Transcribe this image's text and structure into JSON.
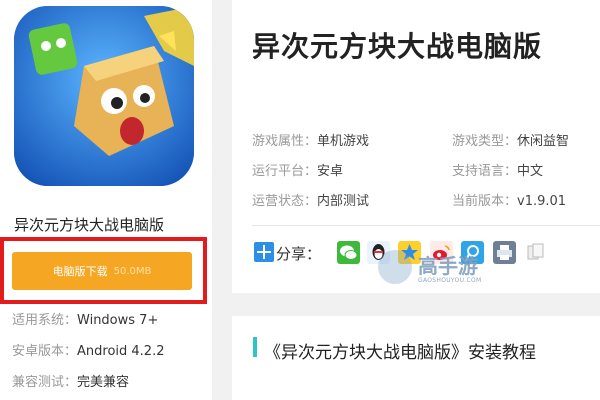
{
  "app": {
    "name": "异次元方块大战电脑版",
    "title": "异次元方块大战电脑版"
  },
  "download": {
    "label": "电脑版下载",
    "size": "50.0MB"
  },
  "specs": [
    {
      "key": "适用系统：",
      "value": "Windows 7+"
    },
    {
      "key": "安卓版本：",
      "value": "Android 4.2.2"
    },
    {
      "key": "兼容测试：",
      "value": "完美兼容"
    }
  ],
  "attributes": [
    {
      "key": "游戏属性：",
      "value": "单机游戏"
    },
    {
      "key": "游戏类型：",
      "value": "休闲益智"
    },
    {
      "key": "运行平台：",
      "value": "安卓"
    },
    {
      "key": "支持语言：",
      "value": "中文"
    },
    {
      "key": "运营状态：",
      "value": "内部测试"
    },
    {
      "key": "当前版本：",
      "value": "v1.9.01"
    }
  ],
  "share": {
    "label": "分享：",
    "icons": [
      "wechat-icon",
      "qq-icon",
      "qzone-icon",
      "weibo-icon",
      "tencent-weibo-icon",
      "print-icon",
      "copy-icon"
    ]
  },
  "watermark": {
    "text": "高手游",
    "sub": "GAOSHOUYOU.COM"
  },
  "section": {
    "title": "《异次元方块大战电脑版》安装教程"
  },
  "colors": {
    "download_button": "#f5a623",
    "highlight_frame": "#e21c1c",
    "accent_bar": "#2ec4c4",
    "share_plus": "#2d8ee8"
  }
}
